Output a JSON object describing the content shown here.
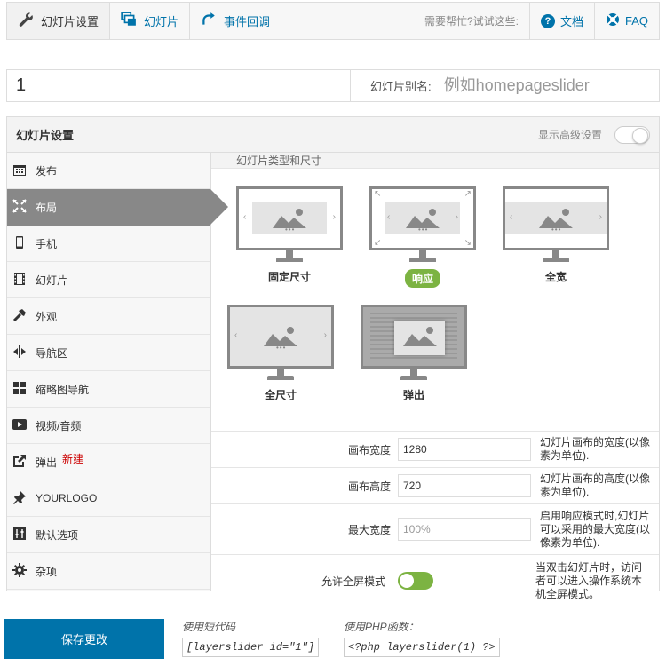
{
  "tabs": [
    {
      "label": "幻灯片设置",
      "icon": "wrench-icon"
    },
    {
      "label": "幻灯片",
      "icon": "slides-icon"
    },
    {
      "label": "事件回调",
      "icon": "redo-icon"
    }
  ],
  "help": {
    "text": "需要帮忙?试试这些:",
    "docs": "文档",
    "faq": "FAQ"
  },
  "title": {
    "value": "1",
    "alias_label": "幻灯片别名:",
    "alias_placeholder": "例如homepageslider"
  },
  "panel": {
    "title": "幻灯片设置",
    "advanced_label": "显示高级设置"
  },
  "sidebar": {
    "items": [
      {
        "label": "发布",
        "icon": "calendar-icon"
      },
      {
        "label": "布局",
        "icon": "expand-icon"
      },
      {
        "label": "手机",
        "icon": "phone-icon"
      },
      {
        "label": "幻灯片",
        "icon": "film-icon"
      },
      {
        "label": "外观",
        "icon": "hammer-icon"
      },
      {
        "label": "导航区",
        "icon": "navigation-icon"
      },
      {
        "label": "缩略图导航",
        "icon": "grid-icon"
      },
      {
        "label": "视频/音频",
        "icon": "play-icon"
      },
      {
        "label": "弹出",
        "icon": "external-link-icon",
        "badge": "新建"
      },
      {
        "label": "YOURLOGO",
        "icon": "pin-icon"
      },
      {
        "label": "默认选项",
        "icon": "sliders-icon"
      },
      {
        "label": "杂项",
        "icon": "gear-icon"
      }
    ]
  },
  "layout": {
    "section_label": "幻灯片类型和尺寸",
    "types": [
      {
        "label": "固定尺寸"
      },
      {
        "label": "响应"
      },
      {
        "label": "全宽"
      },
      {
        "label": "全尺寸"
      },
      {
        "label": "弹出"
      }
    ],
    "width": {
      "label": "画布宽度",
      "value": "1280",
      "help": "幻灯片画布的宽度(以像素为单位)."
    },
    "height": {
      "label": "画布高度",
      "value": "720",
      "help": "幻灯片画布的高度(以像素为单位)."
    },
    "max_width": {
      "label": "最大宽度",
      "placeholder": "100%",
      "help": "启用响应模式时,幻灯片可以采用的最大宽度(以像素为单位)."
    },
    "fullscreen": {
      "label": "允许全屏模式",
      "help": "当双击幻灯片时，访问者可以进入操作系统本机全屏模式。"
    }
  },
  "footer": {
    "save_label": "保存更改",
    "shortcode_label": "使用短代码",
    "shortcode": "[layerslider id=\"1\"]",
    "php_label": "使用PHP函数：",
    "php_code": "<?php layerslider(1) ?>"
  },
  "colors": {
    "accent": "#0073aa",
    "active_sidebar": "#888888",
    "selected_badge": "#7cb342",
    "new_badge": "#cc0000"
  }
}
